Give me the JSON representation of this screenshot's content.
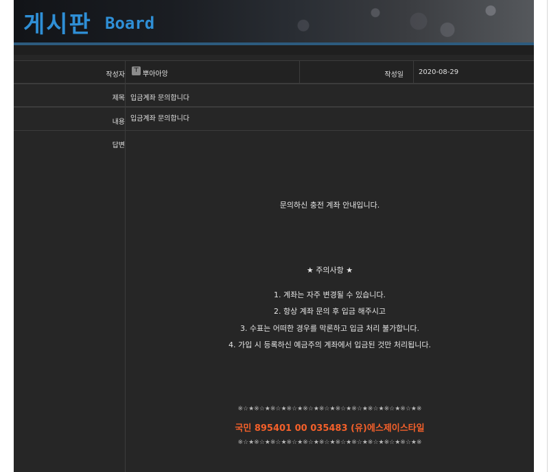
{
  "banner": {
    "title": "게시판",
    "subtitle": "Board"
  },
  "post": {
    "author_label": "작성자",
    "author_name": "뿌아아앙",
    "date_label": "작성일",
    "date_value": "2020-08-29",
    "title_label": "제목",
    "title_value": "입금계좌 문의합니다",
    "content_label": "내용",
    "content_value": "입금계좌 문의합니다",
    "reply_label": "답변"
  },
  "reply": {
    "intro": "문의하신 충전 계좌 안내입니다.",
    "notice_heading": "★  주의사항  ★",
    "notices": [
      "1. 계좌는 자주 변경될 수 있습니다.",
      "2. 항상 계좌 문의 후 입금 해주시고",
      "3. 수표는 어떠한 경우를 막론하고 입금 처리 불가합니다.",
      "4. 가입 시 등록하신 예금주의 계좌에서 입금된 것만 처리됩니다."
    ],
    "stars_top": "※☆★※☆★※☆★※☆★※☆★※☆★※☆★※☆★※☆★※☆★※☆★※",
    "account": "국민  895401 00 035483 (유)에스제이스타일",
    "stars_bottom": "※☆★※☆★※☆★※☆★※☆★※☆★※☆★※☆★※☆★※☆★※☆★※"
  }
}
